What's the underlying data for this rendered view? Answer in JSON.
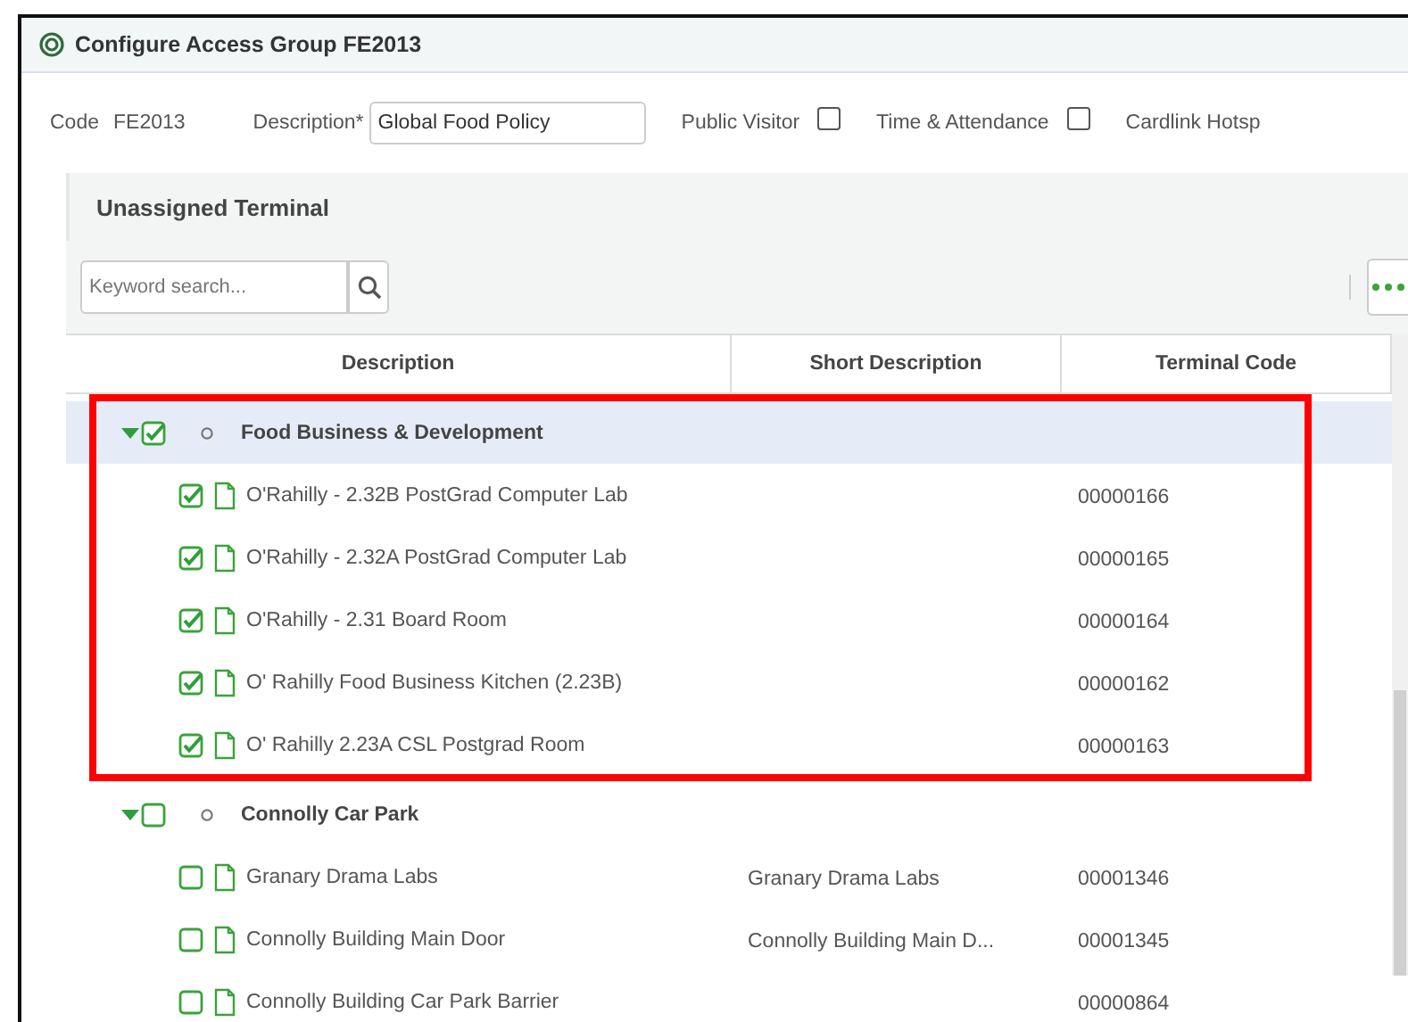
{
  "window": {
    "title": "Configure Access Group FE2013"
  },
  "form": {
    "code_label": "Code",
    "code_value": "FE2013",
    "description_label": "Description*",
    "description_value": "Global Food Policy",
    "checkboxes": [
      {
        "label": "Public Visitor",
        "checked": false
      },
      {
        "label": "Time & Attendance",
        "checked": false
      }
    ],
    "cut_label": "Cardlink Hotsp"
  },
  "panel": {
    "title": "Unassigned Terminal",
    "search": {
      "placeholder": "Keyword search..."
    }
  },
  "table": {
    "columns": [
      "Description",
      "Short Description",
      "Terminal Code"
    ],
    "groups": [
      {
        "label": "Food Business & Development",
        "expanded": true,
        "checked": true,
        "selected": true,
        "annotated": true,
        "children": [
          {
            "description": "O'Rahilly - 2.32B PostGrad Computer Lab",
            "terminal_code": "00000166",
            "checked": true
          },
          {
            "description": "O'Rahilly - 2.32A PostGrad Computer Lab",
            "terminal_code": "00000165",
            "checked": true
          },
          {
            "description": "O'Rahilly - 2.31 Board Room",
            "terminal_code": "00000164",
            "checked": true
          },
          {
            "description": "O' Rahilly Food Business Kitchen (2.23B)",
            "terminal_code": "00000162",
            "checked": true
          },
          {
            "description": "O' Rahilly 2.23A CSL Postgrad Room",
            "terminal_code": "00000163",
            "checked": true
          }
        ]
      },
      {
        "label": "Connolly Car Park",
        "expanded": true,
        "checked": false,
        "selected": false,
        "annotated": false,
        "children": [
          {
            "description": "Granary Drama Labs",
            "short_description": "Granary Drama Labs",
            "terminal_code": "00001346",
            "checked": false
          },
          {
            "description": "Connolly Building Main Door",
            "short_description": "Connolly Building Main D...",
            "terminal_code": "00001345",
            "checked": false
          },
          {
            "description": "Connolly Building Car Park Barrier",
            "terminal_code": "00000864",
            "checked": false
          }
        ]
      }
    ]
  }
}
